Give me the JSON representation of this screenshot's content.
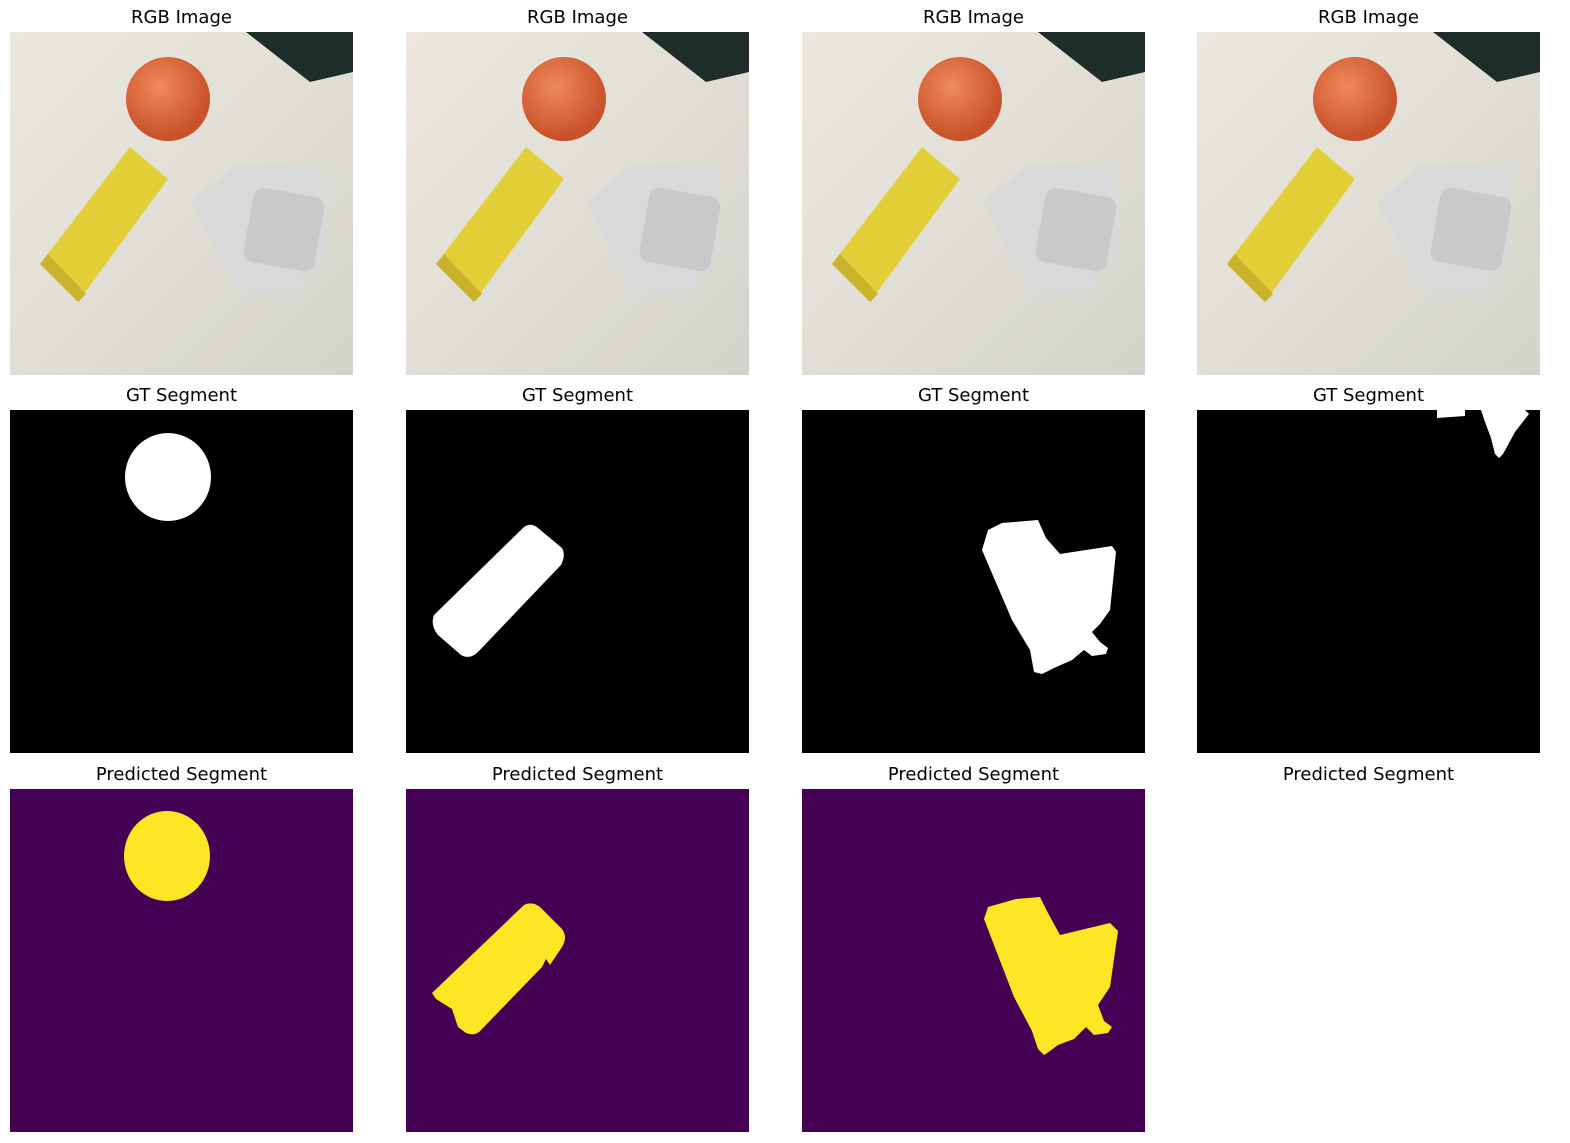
{
  "figure": {
    "titles": {
      "rgb": "RGB Image",
      "gt": "GT Segment",
      "pred": "Predicted Segment"
    },
    "columns": [
      {
        "target": "orange"
      },
      {
        "target": "juice-carton"
      },
      {
        "target": "white-holder"
      },
      {
        "target": "dark-object"
      }
    ],
    "colors": {
      "mask_bg": "#000000",
      "mask_fg": "#ffffff",
      "pred_bg": "#440154",
      "pred_fg": "#fde725",
      "table": "#e5e1d8",
      "orange": "#e06a3c",
      "carton": "#e2cf38",
      "holder": "#d8dad9",
      "dark_object": "#1f2d2a"
    }
  }
}
